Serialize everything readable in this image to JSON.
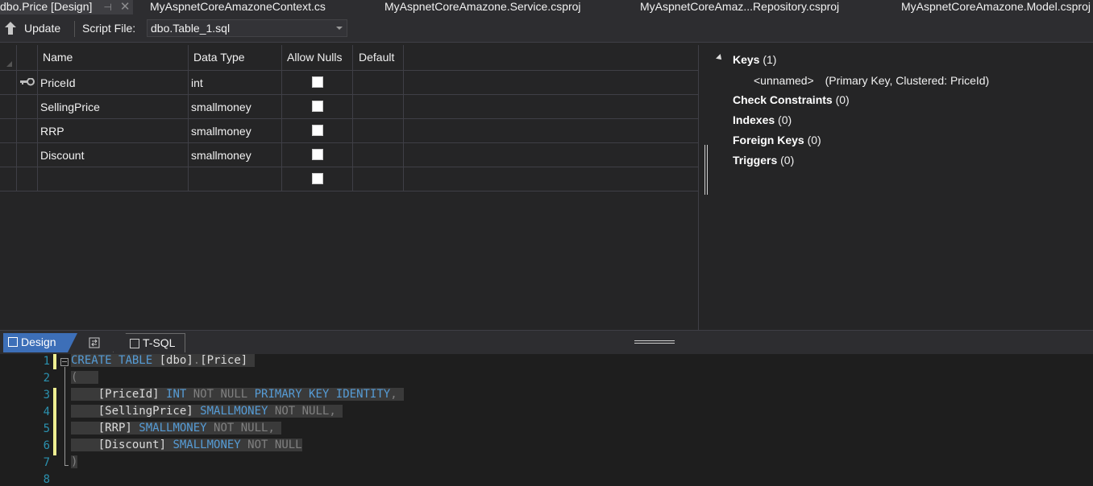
{
  "tabs": [
    {
      "label": "dbo.Price [Design]",
      "active": true
    },
    {
      "label": "MyAspnetCoreAmazoneContext.cs"
    },
    {
      "label": "MyAspnetCoreAmazone.Service.csproj"
    },
    {
      "label": "MyAspnetCoreAmaz...Repository.csproj"
    },
    {
      "label": "MyAspnetCoreAmazone.Model.csproj"
    }
  ],
  "toolbar": {
    "update_label": "Update",
    "script_file_label": "Script File:",
    "script_file_value": "dbo.Table_1.sql"
  },
  "grid": {
    "headers": [
      "Name",
      "Data Type",
      "Allow Nulls",
      "Default"
    ],
    "rows": [
      {
        "name": "PriceId",
        "type": "int",
        "allow_nulls": false,
        "key": true
      },
      {
        "name": "SellingPrice",
        "type": "smallmoney",
        "allow_nulls": false
      },
      {
        "name": "RRP",
        "type": "smallmoney",
        "allow_nulls": false
      },
      {
        "name": "Discount",
        "type": "smallmoney",
        "allow_nulls": false
      },
      {
        "name": "",
        "type": "",
        "allow_nulls": false
      }
    ]
  },
  "props": {
    "keys_label": "Keys",
    "keys_count": "(1)",
    "key_item": "<unnamed>",
    "key_desc": "(Primary Key, Clustered: PriceId)",
    "check_label": "Check Constraints",
    "check_count": "(0)",
    "indexes_label": "Indexes",
    "indexes_count": "(0)",
    "fk_label": "Foreign Keys",
    "fk_count": "(0)",
    "triggers_label": "Triggers",
    "triggers_count": "(0)"
  },
  "panes": {
    "design_label": "Design",
    "tsql_label": "T-SQL"
  },
  "code": {
    "line_numbers": [
      "1",
      "2",
      "3",
      "4",
      "5",
      "6",
      "7",
      "8"
    ]
  },
  "colors": {
    "keyword": "#569cd6",
    "gray": "#808080",
    "line_number": "#2b91af",
    "accent": "#3d6fb8"
  }
}
